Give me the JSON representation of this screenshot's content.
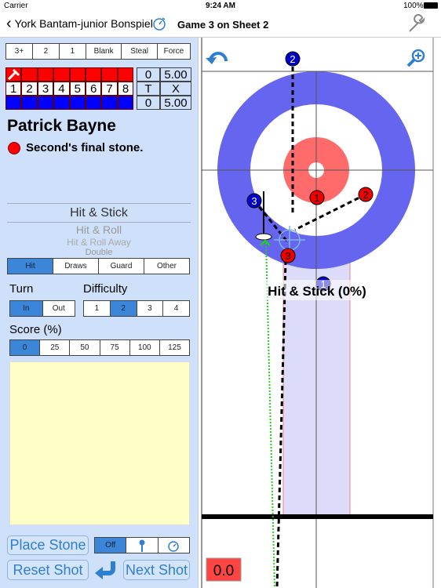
{
  "status": {
    "carrier": "Carrier",
    "time": "9:24 AM",
    "battery": "100%"
  },
  "header": {
    "back_label": "York Bantam-junior Bonspiel",
    "title": "Game 3 on Sheet 2",
    "timer_icon": "stopwatch-icon",
    "settings_icon": "wrench-icon"
  },
  "scoring_options": [
    "3+",
    "2",
    "1",
    "Blank",
    "Steal",
    "Force"
  ],
  "scoreboard": {
    "ends": [
      "1",
      "2",
      "3",
      "4",
      "5",
      "6",
      "7",
      "8"
    ],
    "red_total": "0",
    "red_time": "5.00",
    "mid_left": "T",
    "mid_right": "X",
    "blue_total": "0",
    "blue_time": "5.00",
    "hammer_icon": "hammer-icon",
    "colors": {
      "red": "#ff0000",
      "blue": "#0000ff"
    }
  },
  "player": {
    "name": "Patrick Bayne",
    "stone_desc": "Second's final stone.",
    "stone_color": "#ff0000"
  },
  "shot_picker": {
    "selected": "Hit & Stick",
    "options": [
      "Hit & Roll",
      "Hit & Roll Away",
      "Double"
    ]
  },
  "shot_types": {
    "options": [
      "Hit",
      "Draws",
      "Guard",
      "Other"
    ],
    "selected": "Hit"
  },
  "turn": {
    "label": "Turn",
    "options": [
      "In",
      "Out"
    ],
    "selected": "In"
  },
  "difficulty": {
    "label": "Difficulty",
    "options": [
      "1",
      "2",
      "3",
      "4"
    ],
    "selected": "2"
  },
  "score": {
    "label": "Score (%)",
    "options": [
      "0",
      "25",
      "50",
      "75",
      "100",
      "125"
    ],
    "selected": "0"
  },
  "buttons": {
    "place_stone": "Place Stone",
    "reset_shot": "Reset Shot",
    "next_shot": "Next Shot",
    "mode_off": "Off"
  },
  "sheet": {
    "shot_label": "Hit & Stick (0%)",
    "timer_value": "0.0",
    "stones": [
      {
        "color": "blue",
        "num": "2"
      },
      {
        "color": "blue",
        "num": "3"
      },
      {
        "color": "blue",
        "num": "1"
      },
      {
        "color": "red",
        "num": "1"
      },
      {
        "color": "red",
        "num": "2"
      },
      {
        "color": "red",
        "num": "3"
      }
    ],
    "colors": {
      "twelve_foot": "#6565f0",
      "four_foot": "#ff6b6b",
      "lane": "#dcdcfa"
    }
  }
}
